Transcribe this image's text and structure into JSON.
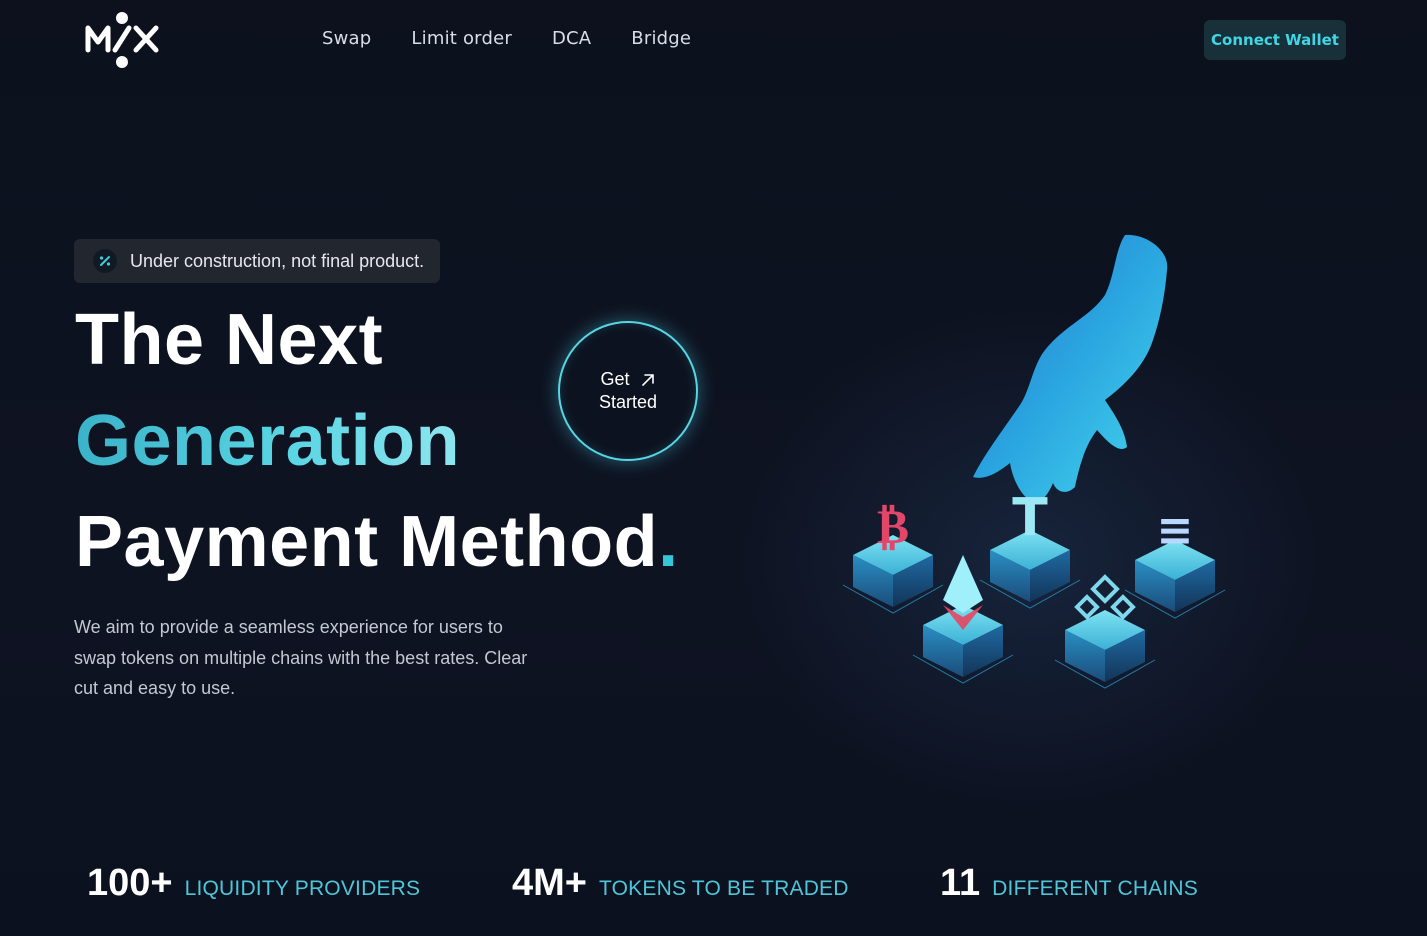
{
  "header": {
    "logo_alt": "MIX",
    "nav": [
      "Swap",
      "Limit order",
      "DCA",
      "Bridge"
    ],
    "connect_label": "Connect Wallet"
  },
  "banner": {
    "text": "Under construction, not final product."
  },
  "hero": {
    "line1": "The Next",
    "line2": "Generation",
    "line3": "Payment Method",
    "line3_dot": ".",
    "description": "We aim to provide a seamless experience for users to swap tokens on multiple chains with the best rates. Clear cut and easy to use."
  },
  "cta": {
    "line1": "Get",
    "line2": "Started"
  },
  "stats": [
    {
      "value": "100+",
      "label": "LIQUIDITY PROVIDERS"
    },
    {
      "value": "4M+",
      "label": "TOKENS TO BE TRADED"
    },
    {
      "value": "11",
      "label": "DIFFERENT CHAINS"
    }
  ],
  "colors": {
    "accent": "#4ec6d8",
    "background": "#0d1220",
    "button_bg": "#17303a"
  }
}
